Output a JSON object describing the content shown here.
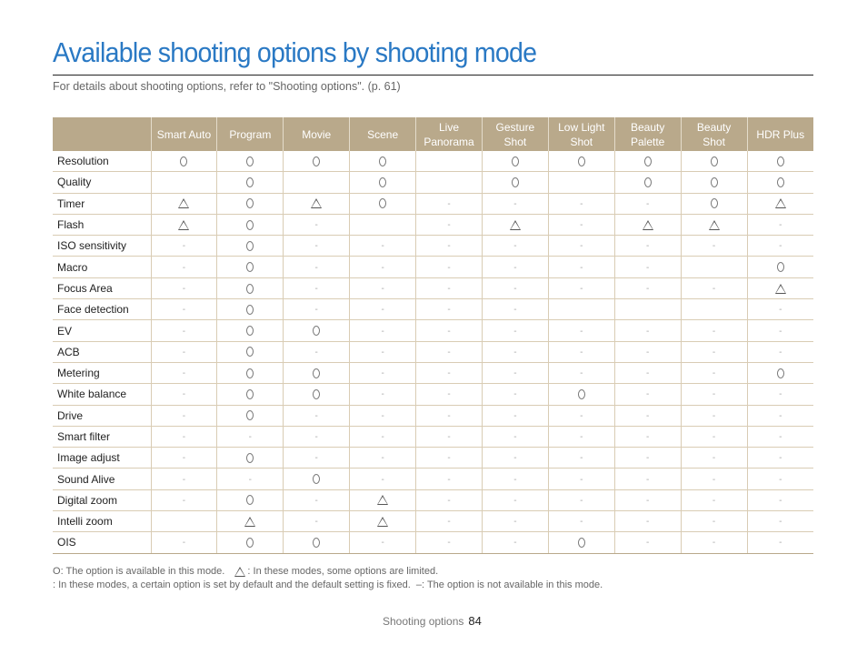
{
  "page": {
    "title": "Available shooting options by shooting mode",
    "subtitle": "For details about shooting options, refer to \"Shooting options\". (p. 61)"
  },
  "table": {
    "columns": [
      "Smart Auto",
      "Program",
      "Movie",
      "Scene",
      "Live Panorama",
      "Gesture Shot",
      "Low Light Shot",
      "Beauty Palette",
      "Beauty Shot",
      "HDR Plus"
    ],
    "column_lines": [
      [
        "Smart Auto"
      ],
      [
        "Program"
      ],
      [
        "Movie"
      ],
      [
        "Scene"
      ],
      [
        "Live",
        "Panorama"
      ],
      [
        "Gesture",
        "Shot"
      ],
      [
        "Low Light",
        "Shot"
      ],
      [
        "Beauty",
        "Palette"
      ],
      [
        "Beauty",
        "Shot"
      ],
      [
        "HDR Plus"
      ]
    ],
    "symbol_key": {
      "O": "available",
      "T": "limited",
      "-": "not available",
      "": "set by default (fixed)"
    },
    "rows": [
      {
        "label": "Resolution",
        "values": [
          "O",
          "O",
          "O",
          "O",
          "",
          "O",
          "O",
          "O",
          "O",
          "O"
        ]
      },
      {
        "label": "Quality",
        "values": [
          "",
          "O",
          "",
          "O",
          "",
          "O",
          "",
          "O",
          "O",
          "O"
        ]
      },
      {
        "label": "Timer",
        "values": [
          "T",
          "O",
          "T",
          "O",
          "-",
          "-",
          "-",
          "-",
          "O",
          "T"
        ]
      },
      {
        "label": "Flash",
        "values": [
          "T",
          "O",
          "-",
          "",
          "-",
          "T",
          "-",
          "T",
          "T",
          "-"
        ]
      },
      {
        "label": "ISO sensitivity",
        "values": [
          "-",
          "O",
          "-",
          "-",
          "-",
          "-",
          "-",
          "-",
          "-",
          "-"
        ]
      },
      {
        "label": "Macro",
        "values": [
          "-",
          "O",
          "-",
          "-",
          "-",
          "-",
          "-",
          "-",
          "",
          "O"
        ]
      },
      {
        "label": "Focus Area",
        "values": [
          "-",
          "O",
          "-",
          "-",
          "-",
          "-",
          "-",
          "-",
          "-",
          "T"
        ]
      },
      {
        "label": "Face detection",
        "values": [
          "-",
          "O",
          "-",
          "-",
          "-",
          "-",
          "",
          "",
          "",
          "-"
        ]
      },
      {
        "label": "EV",
        "values": [
          "-",
          "O",
          "O",
          "-",
          "-",
          "-",
          "-",
          "-",
          "-",
          "-"
        ]
      },
      {
        "label": "ACB",
        "values": [
          "-",
          "O",
          "-",
          "-",
          "-",
          "-",
          "-",
          "-",
          "-",
          "-"
        ]
      },
      {
        "label": "Metering",
        "values": [
          "-",
          "O",
          "O",
          "-",
          "-",
          "-",
          "-",
          "-",
          "-",
          "O"
        ]
      },
      {
        "label": "White balance",
        "values": [
          "-",
          "O",
          "O",
          "-",
          "-",
          "-",
          "O",
          "-",
          "-",
          "-"
        ]
      },
      {
        "label": "Drive",
        "values": [
          "-",
          "O",
          "-",
          "-",
          "-",
          "-",
          "-",
          "-",
          "-",
          "-"
        ]
      },
      {
        "label": "Smart filter",
        "values": [
          "-",
          "-",
          "-",
          "-",
          "-",
          "-",
          "-",
          "-",
          "-",
          "-"
        ]
      },
      {
        "label": "Image adjust",
        "values": [
          "-",
          "O",
          "-",
          "-",
          "-",
          "-",
          "-",
          "-",
          "-",
          "-"
        ]
      },
      {
        "label": "Sound Alive",
        "values": [
          "-",
          "-",
          "O",
          "-",
          "-",
          "-",
          "-",
          "-",
          "-",
          "-"
        ]
      },
      {
        "label": "Digital zoom",
        "values": [
          "-",
          "O",
          "-",
          "T",
          "-",
          "-",
          "-",
          "-",
          "-",
          "-"
        ]
      },
      {
        "label": "Intelli zoom",
        "values": [
          "",
          "T",
          "-",
          "T",
          "-",
          "-",
          "-",
          "-",
          "-",
          "-"
        ]
      },
      {
        "label": "OIS",
        "values": [
          "-",
          "O",
          "O",
          "-",
          "-",
          "-",
          "O",
          "-",
          "-",
          "-"
        ]
      }
    ]
  },
  "legend": {
    "available_prefix": "O",
    "available_text": ": The option is available in this mode.",
    "limited_text": ": In these modes, some options are limited.",
    "default_text": ": In these modes, a certain option is set by default and the default setting is fixed.",
    "na_text": "–: The option is not available in this mode."
  },
  "footer": {
    "section": "Shooting options",
    "page_number": "84"
  }
}
